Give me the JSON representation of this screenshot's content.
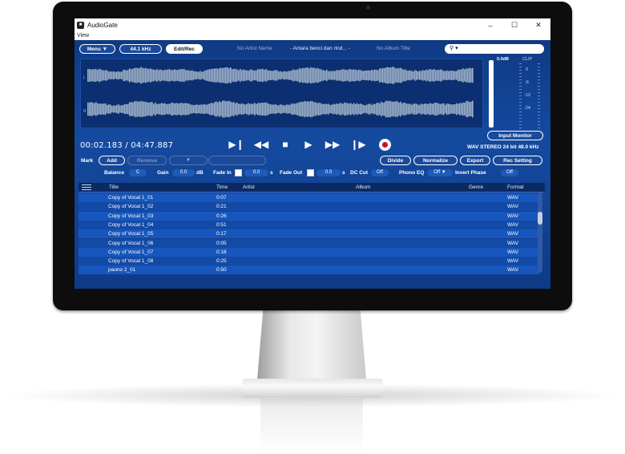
{
  "window": {
    "title": "AudioGate",
    "menu": "View"
  },
  "toolbar": {
    "menu_label": "Menu",
    "rate_label": "44.1 kHz",
    "mode_label": "Edit/Rec",
    "artist_placeholder": "No Artist Name",
    "track_title": "- Antara benci dan rind... -",
    "album_placeholder": "No Album Title"
  },
  "meter": {
    "db_label": "0.0dB",
    "clip_label": "CLIP",
    "scale": [
      "0",
      "-6",
      "-12",
      "-24"
    ],
    "input_monitor_label": "Input Monitor"
  },
  "transport": {
    "time_current": "00:02.183",
    "time_sep": "/",
    "time_total": "04:47.887",
    "format_info": "WAV STEREO 24 bit 48.0 kHz",
    "buttons": [
      "▶❙",
      "◀◀",
      "■",
      "▶",
      "▶▶",
      "❙▶"
    ]
  },
  "mark": {
    "label": "Mark",
    "add_label": "Add",
    "remove_label": "Remove",
    "dropdown_arrow": "▼"
  },
  "actions": {
    "divide": "Divide",
    "normalize": "Normalize",
    "export": "Export",
    "rec_setting": "Rec Setting"
  },
  "params": {
    "balance_label": "Balance",
    "balance_value": "C",
    "gain_label": "Gain",
    "gain_value": "0.0",
    "gain_unit": "dB",
    "fadein_label": "Fade In",
    "fadein_value": "0.0",
    "fadein_unit": "s",
    "fadeout_label": "Fade Out",
    "fadeout_value": "0.0",
    "fadeout_unit": "s",
    "dccut_label": "DC Cut",
    "dccut_value": "Off",
    "phonoeq_label": "Phono EQ",
    "phonoeq_value": "Off ▼",
    "invert_label": "Invert Phase",
    "invert_value": "Off"
  },
  "table": {
    "columns": [
      "Title",
      "Time",
      "Artist",
      "Album",
      "Genre",
      "Format"
    ],
    "rows": [
      {
        "title": "Copy of Vocal 1_01",
        "time": "0:07",
        "format": "WAV"
      },
      {
        "title": "Copy of Vocal 1_02",
        "time": "0:21",
        "format": "WAV"
      },
      {
        "title": "Copy of Vocal 1_03",
        "time": "0:26",
        "format": "WAV"
      },
      {
        "title": "Copy of Vocal 1_04",
        "time": "0:51",
        "format": "WAV"
      },
      {
        "title": "Copy of Vocal 1_05",
        "time": "0:17",
        "format": "WAV"
      },
      {
        "title": "Copy of Vocal 1_06",
        "time": "0:05",
        "format": "WAV"
      },
      {
        "title": "Copy of Vocal 1_07",
        "time": "0:18",
        "format": "WAV"
      },
      {
        "title": "Copy of Vocal 1_08",
        "time": "0:25",
        "format": "WAV"
      },
      {
        "title": "paono 2_01",
        "time": "0:50",
        "format": "WAV"
      }
    ]
  },
  "colors": {
    "accent": "#113e8c",
    "record": "#c0142a"
  }
}
